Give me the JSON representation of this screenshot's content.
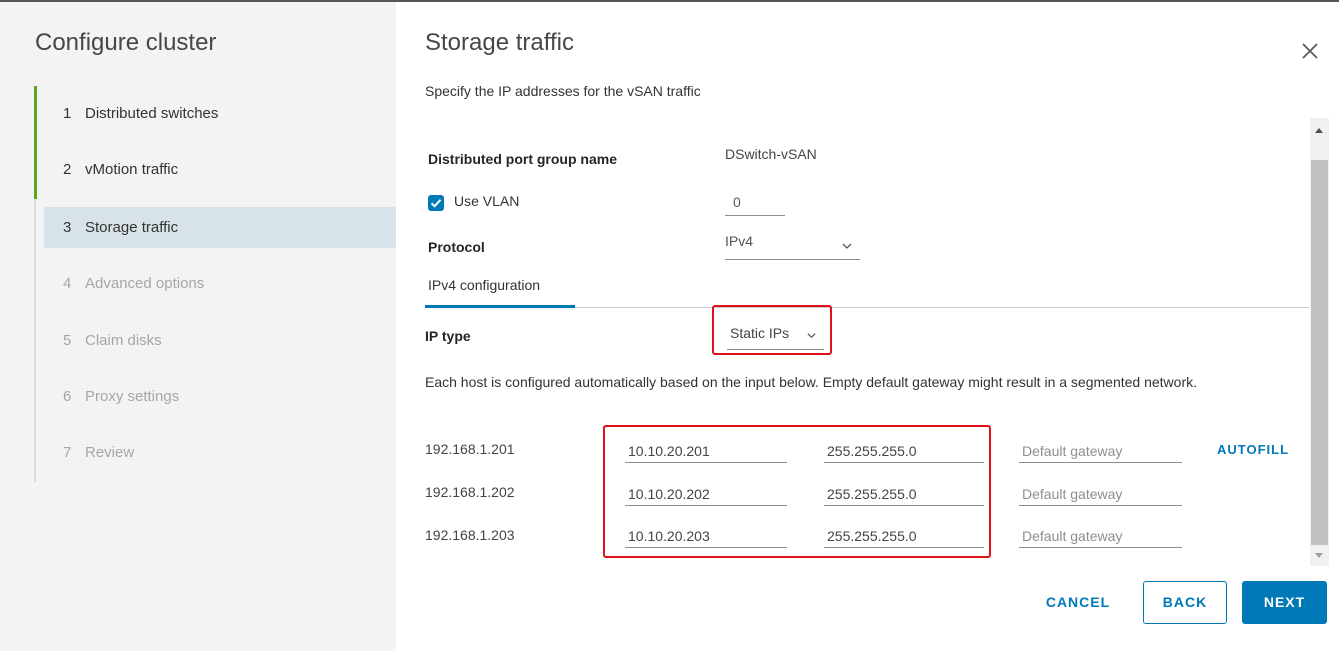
{
  "wizard": {
    "title": "Configure cluster",
    "steps": [
      {
        "num": "1",
        "label": "Distributed switches",
        "state": "completed"
      },
      {
        "num": "2",
        "label": "vMotion traffic",
        "state": "completed"
      },
      {
        "num": "3",
        "label": "Storage traffic",
        "state": "active"
      },
      {
        "num": "4",
        "label": "Advanced options",
        "state": "disabled"
      },
      {
        "num": "5",
        "label": "Claim disks",
        "state": "disabled"
      },
      {
        "num": "6",
        "label": "Proxy settings",
        "state": "disabled"
      },
      {
        "num": "7",
        "label": "Review",
        "state": "disabled"
      }
    ]
  },
  "page": {
    "title": "Storage traffic",
    "subtitle": "Specify the IP addresses for the vSAN traffic",
    "close_icon": "close-icon"
  },
  "form": {
    "port_group_label": "Distributed port group name",
    "port_group_value": "DSwitch-vSAN",
    "use_vlan_label": "Use VLAN",
    "use_vlan_checked": true,
    "vlan_value": "0",
    "protocol_label": "Protocol",
    "protocol_value": "IPv4",
    "tab_label": "IPv4 configuration",
    "ip_type_label": "IP type",
    "ip_type_value": "Static IPs",
    "description": "Each host is configured automatically based on the input below. Empty default gateway might result in a segmented network.",
    "autofill_label": "AUTOFILL",
    "hosts": [
      {
        "host": "192.168.1.201",
        "ip": "10.10.20.201",
        "mask": "255.255.255.0",
        "gateway_placeholder": "Default gateway"
      },
      {
        "host": "192.168.1.202",
        "ip": "10.10.20.202",
        "mask": "255.255.255.0",
        "gateway_placeholder": "Default gateway"
      },
      {
        "host": "192.168.1.203",
        "ip": "10.10.20.203",
        "mask": "255.255.255.0",
        "gateway_placeholder": "Default gateway"
      }
    ]
  },
  "footer": {
    "cancel_label": "CANCEL",
    "back_label": "BACK",
    "next_label": "NEXT"
  },
  "colors": {
    "accent": "#0079b8",
    "progress": "#62a420",
    "highlight": "#e0111a",
    "active_step_bg": "#d8e3e9"
  }
}
